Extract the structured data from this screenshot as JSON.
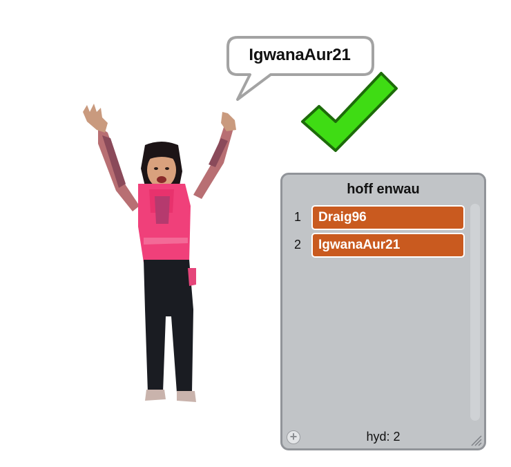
{
  "speech_bubble": {
    "text": "IgwanaAur21"
  },
  "check_mark": {
    "icon": "check-mark-icon",
    "color": "#3fdc14"
  },
  "sprite": {
    "icon": "girl-arms-raised-sprite"
  },
  "list_monitor": {
    "title": "hoff enwau",
    "items": [
      {
        "index": "1",
        "value": "Draig96"
      },
      {
        "index": "2",
        "value": "IgwanaAur21"
      }
    ],
    "length_label": "hyd: 2",
    "add_icon": "plus-icon",
    "resize_icon": "resize-handle-icon",
    "cell_color": "#c95a1f"
  }
}
